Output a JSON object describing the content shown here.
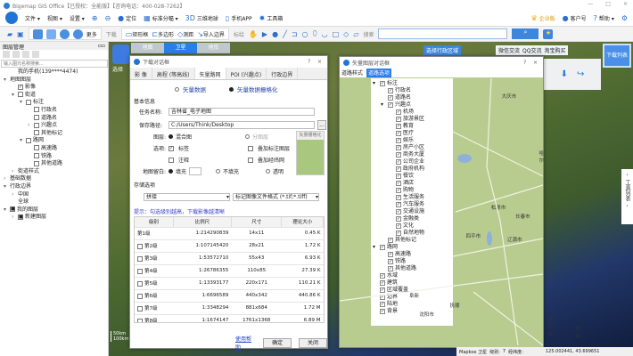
{
  "app": {
    "title": "Bigemap GIS Office【已授权：全能版】【咨询电话：400-028-7262】",
    "window_controls": [
      "—",
      "□",
      "×"
    ]
  },
  "menu": {
    "items": [
      "文件 ▾",
      "视图 ▾",
      "设置 ▾"
    ],
    "locate": "定位",
    "grid": "标准分幅 ▾",
    "globe": "三维地球",
    "mobile": "手机APP",
    "toolbox": "工具箱",
    "enterprise": "企业版",
    "account": "客户号",
    "help": "帮助 ▾"
  },
  "toolbar": {
    "more": "更多",
    "download_label": "下载",
    "rect": "矩形框",
    "polygon": "多边形",
    "measure": "测距",
    "import": "导入边界",
    "mark_label": "标绘",
    "search_label": "搜索",
    "search_placeholder": ""
  },
  "map": {
    "tabs": [
      "地图",
      "卫星",
      "地形"
    ],
    "active_tab": 1,
    "select_admin": "选择行政区域",
    "wechat": "微信交流",
    "qq": "QQ交流",
    "taobao": "淘宝购买",
    "download_list": "下载列表",
    "tool_list": "工具列表",
    "select_label": "选择",
    "scale": "50km",
    "scale2": "100km",
    "status": {
      "source": "Mapbox 卫星",
      "level_label": "级别:",
      "level": "7",
      "coord_label": "经纬度:",
      "coord": "125.002441, 43.699651"
    }
  },
  "layers": {
    "title": "图层管理",
    "search_placeholder": "输入图元名称搜索...",
    "tree": [
      {
        "d": 1,
        "t": "我的手机(139****4474)",
        "c": "",
        "e": ""
      },
      {
        "d": 0,
        "t": "地图图层",
        "c": "",
        "e": "▾"
      },
      {
        "d": 1,
        "t": "影像",
        "c": "✓",
        "e": ""
      },
      {
        "d": 1,
        "t": "街道",
        "c": " ",
        "e": "▾"
      },
      {
        "d": 2,
        "t": "标注",
        "c": " ",
        "e": "▾"
      },
      {
        "d": 3,
        "t": "行政名",
        "c": " ",
        "e": ""
      },
      {
        "d": 3,
        "t": "道路名",
        "c": " ",
        "e": ""
      },
      {
        "d": 3,
        "t": "兴趣点",
        "c": " ",
        "e": "›"
      },
      {
        "d": 3,
        "t": "其他标记",
        "c": " ",
        "e": ""
      },
      {
        "d": 2,
        "t": "路网",
        "c": " ",
        "e": "▾"
      },
      {
        "d": 3,
        "t": "高速路",
        "c": " ",
        "e": ""
      },
      {
        "d": 3,
        "t": "铁路",
        "c": " ",
        "e": ""
      },
      {
        "d": 3,
        "t": "其他道路",
        "c": " ",
        "e": ""
      },
      {
        "d": 1,
        "t": "街道样式",
        "c": "",
        "e": "›"
      },
      {
        "d": 0,
        "t": "基础数据",
        "c": "",
        "e": "›"
      },
      {
        "d": 0,
        "t": "行政边界",
        "c": "",
        "e": "▾"
      },
      {
        "d": 1,
        "t": "中国",
        "c": "",
        "e": "›"
      },
      {
        "d": 1,
        "t": "全球",
        "c": "",
        "e": ""
      },
      {
        "d": 0,
        "t": "我的图层",
        "c": "■",
        "e": "▾"
      },
      {
        "d": 1,
        "t": "新建图层",
        "c": "■",
        "e": "›"
      }
    ]
  },
  "download_dialog": {
    "title": "下载对话框",
    "help": "?",
    "close": "×",
    "tabs": [
      "影 像",
      "高程 (等高线)",
      "矢量路网",
      "POI (兴趣点)",
      "行政边界"
    ],
    "active_tab": 2,
    "mode": [
      "矢量数据",
      "矢量数据栅格化"
    ],
    "basic_info": "基本信息",
    "task_label": "任务名称:",
    "task_value": "吉林省_电子地图",
    "path_label": "保存路径:",
    "path_value": "C:/Users/Think/Desktop",
    "browse": "...",
    "layer_label": "图层:",
    "layer_opts": [
      "混合图",
      "分图层"
    ],
    "options_label": "选项:",
    "opt_label": "标签",
    "opt_overlay": "叠加标注图层",
    "opt_note": "注释",
    "opt_grid": "叠加经纬网",
    "blank_label": "地图留白:",
    "blank_opts": [
      "填充",
      "不填充",
      "透明"
    ],
    "preview_title": "矢量栅格化",
    "storage": "存储选项",
    "storage_mode": "拼接",
    "format": "标记图像文件格式 (*.tif;*.tiff)",
    "tip": "提示：勾选级别越高，下载影像越清晰",
    "columns": [
      "级别",
      "比例尺",
      "尺寸",
      "理论大小"
    ],
    "rows": [
      [
        "第1级",
        "1:214290839",
        "14x11",
        "0.45 K"
      ],
      [
        "第2级",
        "1:107145420",
        "28x21",
        "1.72 K"
      ],
      [
        "第3级",
        "1:53572710",
        "55x43",
        "6.93 K"
      ],
      [
        "第4级",
        "1:26786355",
        "110x85",
        "27.39 K"
      ],
      [
        "第5级",
        "1:13393177",
        "220x171",
        "110.21 K"
      ],
      [
        "第6级",
        "1:6696589",
        "440x342",
        "440.86 K"
      ],
      [
        "第7级",
        "1:3348294",
        "881x684",
        "1.72 M"
      ],
      [
        "第8级",
        "1:1674147",
        "1761x1368",
        "6.89 M"
      ]
    ],
    "help_link": "使用帮助",
    "ok": "确定",
    "close_btn": "关闭"
  },
  "vector_dialog": {
    "title": "矢量图层对话框",
    "help": "?",
    "close": "×",
    "tabs": [
      "道路样式",
      "道路选项"
    ],
    "active_tab": 1,
    "tree": [
      {
        "d": 0,
        "t": "标注",
        "e": "▾"
      },
      {
        "d": 1,
        "t": "行政名"
      },
      {
        "d": 1,
        "t": "道路名"
      },
      {
        "d": 1,
        "t": "兴趣点",
        "e": "▾"
      },
      {
        "d": 2,
        "t": "机场"
      },
      {
        "d": 2,
        "t": "旅游景区"
      },
      {
        "d": 2,
        "t": "教育"
      },
      {
        "d": 2,
        "t": "医疗"
      },
      {
        "d": 2,
        "t": "娱乐"
      },
      {
        "d": 2,
        "t": "房产小区"
      },
      {
        "d": 2,
        "t": "商务大厦"
      },
      {
        "d": 2,
        "t": "公司企业"
      },
      {
        "d": 2,
        "t": "政府机构"
      },
      {
        "d": 2,
        "t": "餐饮"
      },
      {
        "d": 2,
        "t": "酒店"
      },
      {
        "d": 2,
        "t": "购物"
      },
      {
        "d": 2,
        "t": "生活服务"
      },
      {
        "d": 2,
        "t": "汽车服务"
      },
      {
        "d": 2,
        "t": "交通设施"
      },
      {
        "d": 2,
        "t": "金融类"
      },
      {
        "d": 2,
        "t": "文化"
      },
      {
        "d": 2,
        "t": "自然地物"
      },
      {
        "d": 1,
        "t": "其他标记"
      },
      {
        "d": 0,
        "t": "路网",
        "e": "▾"
      },
      {
        "d": 1,
        "t": "高速路"
      },
      {
        "d": 1,
        "t": "铁路"
      },
      {
        "d": 1,
        "t": "其他道路"
      },
      {
        "d": 0,
        "t": "水域"
      },
      {
        "d": 0,
        "t": "建筑"
      },
      {
        "d": 0,
        "t": "区域覆盖"
      },
      {
        "d": 0,
        "t": "边界"
      },
      {
        "d": 0,
        "t": "陆地"
      },
      {
        "d": 0,
        "t": "背景"
      }
    ],
    "cities": [
      "大庆市",
      "哈尔",
      "松原市",
      "长春市",
      "四平市",
      "辽源市",
      "沈阳市",
      "抚顺",
      "通化市",
      "白山",
      "阜新"
    ]
  },
  "colors": {
    "accent": "#2a7ee8",
    "vector_land": "#b9cc8f"
  }
}
